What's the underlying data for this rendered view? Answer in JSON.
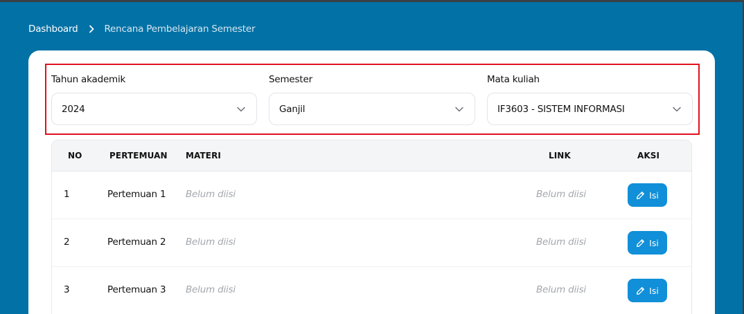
{
  "breadcrumb": {
    "home": "Dashboard",
    "separator_icon": "chevron-right-icon",
    "current": "Rencana Pembelajaran Semester"
  },
  "filters": {
    "tahun_akademik": {
      "label": "Tahun akademik",
      "value": "2024",
      "icon": "chevron-down-icon"
    },
    "semester": {
      "label": "Semester",
      "value": "Ganjil",
      "icon": "chevron-down-icon"
    },
    "mata_kuliah": {
      "label": "Mata kuliah",
      "value": "IF3603 - SISTEM INFORMASI",
      "icon": "chevron-down-icon"
    }
  },
  "table": {
    "headers": {
      "no": "NO",
      "pertemuan": "PERTEMUAN",
      "materi": "MATERI",
      "link": "LINK",
      "aksi": "AKSI"
    },
    "rows": [
      {
        "no": "1",
        "pertemuan": "Pertemuan 1",
        "materi": "Belum diisi",
        "link": "Belum diisi",
        "action": "Isi"
      },
      {
        "no": "2",
        "pertemuan": "Pertemuan 2",
        "materi": "Belum diisi",
        "link": "Belum diisi",
        "action": "Isi"
      },
      {
        "no": "3",
        "pertemuan": "Pertemuan 3",
        "materi": "Belum diisi",
        "link": "Belum diisi",
        "action": "Isi"
      }
    ]
  },
  "colors": {
    "page_background": "#0271a6",
    "highlight_border": "#e0101d",
    "button": "#118fd8",
    "muted_text": "#a3a7ad"
  }
}
